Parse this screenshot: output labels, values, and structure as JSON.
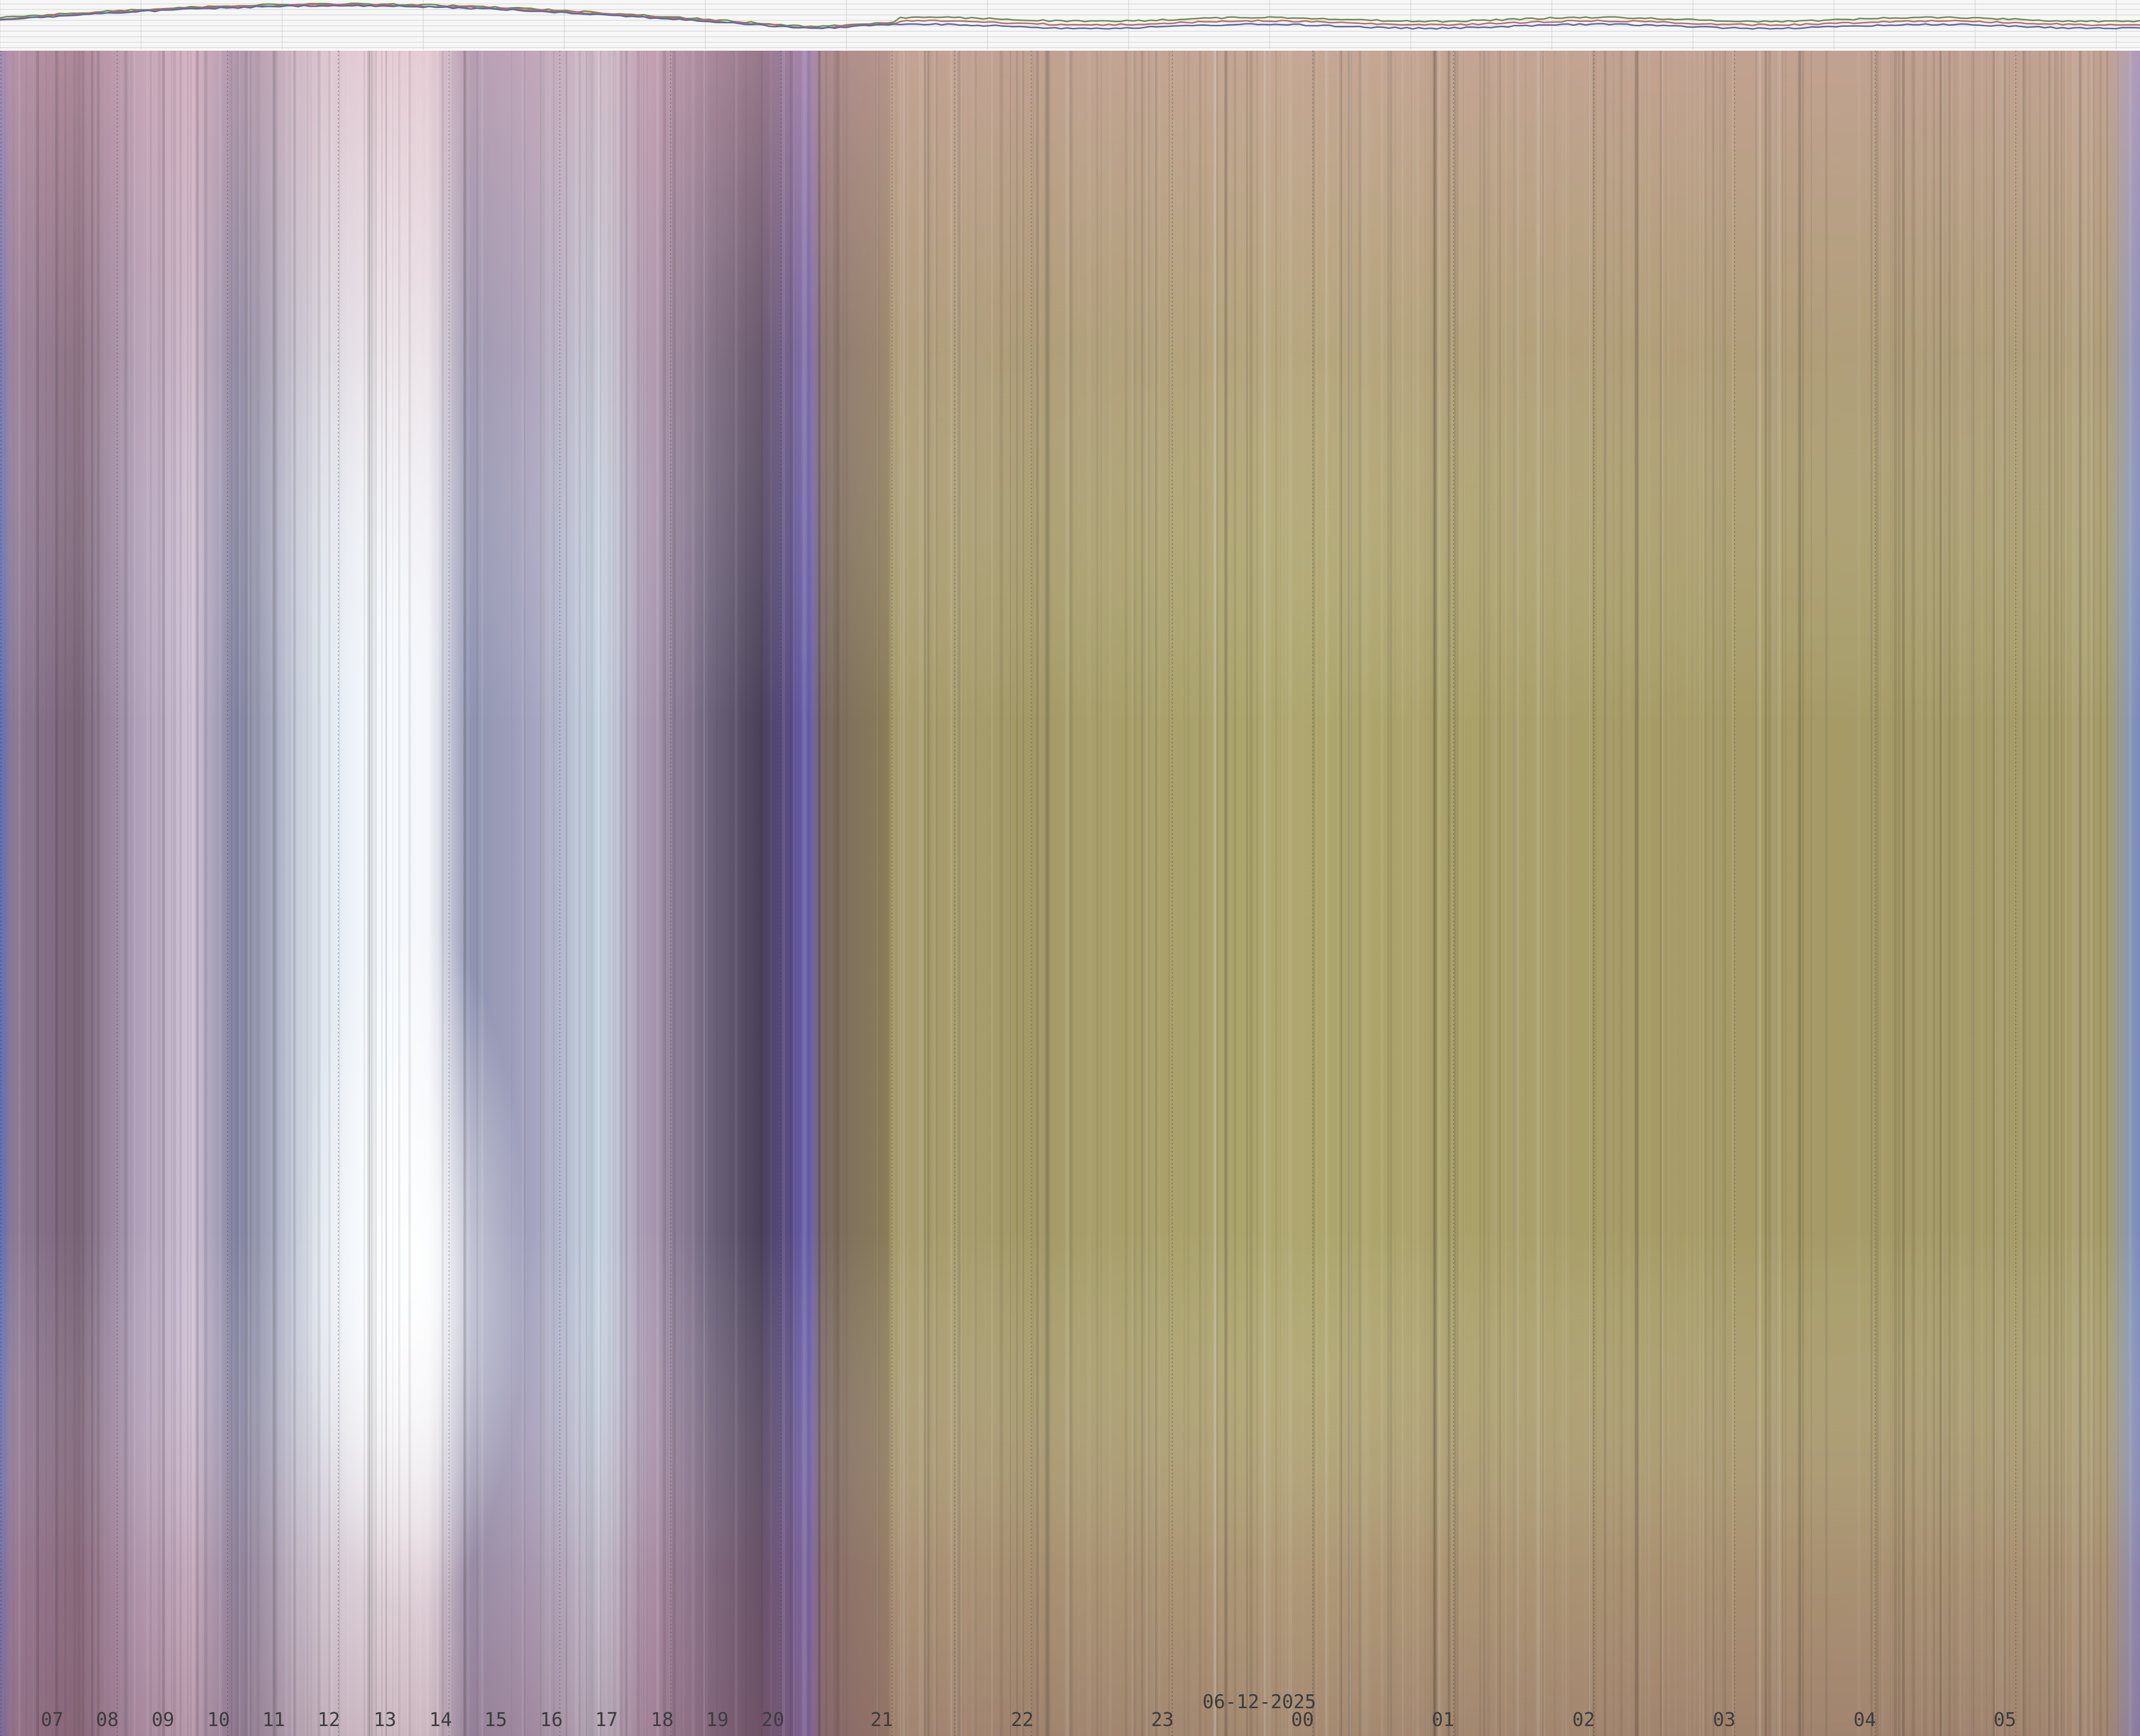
{
  "chart_data": {
    "type": "heatmap",
    "title": "",
    "xlabel": "",
    "ylabel": "",
    "date_label": "06-12-2025",
    "hour_ticks": [
      "07",
      "08",
      "09",
      "10",
      "11",
      "12",
      "13",
      "14",
      "15",
      "16",
      "17",
      "18",
      "19",
      "20",
      "21",
      "22",
      "23",
      "00",
      "01",
      "02",
      "03",
      "04",
      "05"
    ],
    "grid": true,
    "header_strip": {
      "series": [
        {
          "color": "#6b8f4e"
        },
        {
          "color": "#c06a6a"
        },
        {
          "color": "#5b6aa8"
        }
      ]
    },
    "palette": {
      "dusk_band": "#6a5ca8",
      "night_olive": "#a8a26a",
      "day_pale": "#e8f0f8",
      "day_mauve": "#a98bb0"
    }
  }
}
